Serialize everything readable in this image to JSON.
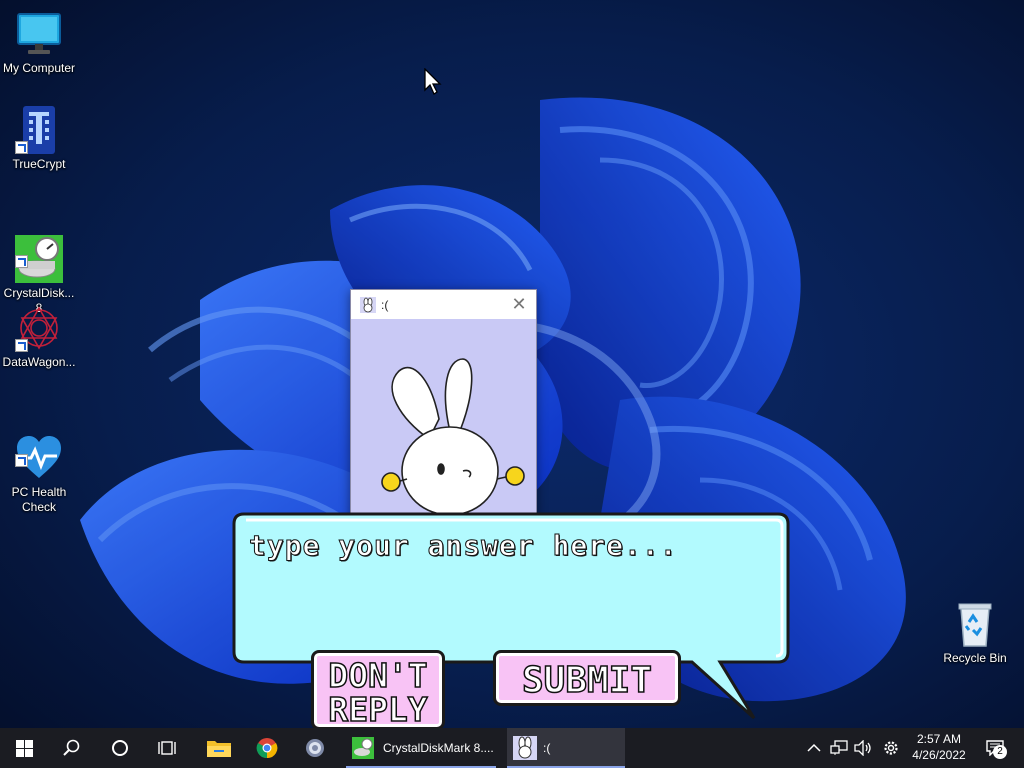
{
  "desktop": {
    "icons": [
      {
        "label": "My Computer"
      },
      {
        "label": "TrueCrypt"
      },
      {
        "label": "CrystalDisk...\n8"
      },
      {
        "label": "DataWagon..."
      },
      {
        "label": "PC Health\nCheck"
      },
      {
        "label": "Recycle Bin"
      }
    ]
  },
  "popup": {
    "title": ":(",
    "close_icon": "close-icon",
    "illustration": "white bunny character with yellow hands"
  },
  "bubble": {
    "placeholder": "type your answer here...",
    "value": "",
    "dont_reply_label": "DON'T\nREPLY",
    "submit_label": "SUBMIT"
  },
  "taskbar": {
    "start_icon": "windows-start-icon",
    "search_icon": "search-icon",
    "cortana_icon": "cortana-circle-icon",
    "taskview_icon": "task-view-icon",
    "pinned": [
      "file-explorer-icon",
      "chrome-icon",
      "settings-icon"
    ],
    "apps": [
      {
        "label": "CrystalDiskMark 8....",
        "icon": "crystaldiskmark-icon"
      },
      {
        "label": ":(",
        "icon": "bunny-app-icon"
      }
    ],
    "tray": {
      "chevron_icon": "chevron-up-icon",
      "network_icon": "network-icon",
      "volume_icon": "volume-icon",
      "settings_icon": "gear-icon",
      "time": "2:57 AM",
      "date": "4/26/2022",
      "notifications_count": "2"
    }
  },
  "colors": {
    "taskbar_bg": "#1b1c22",
    "bubble_fill": "#b2fafe",
    "button_fill": "#f8c3f5",
    "popup_bg": "#c9c9f5"
  }
}
